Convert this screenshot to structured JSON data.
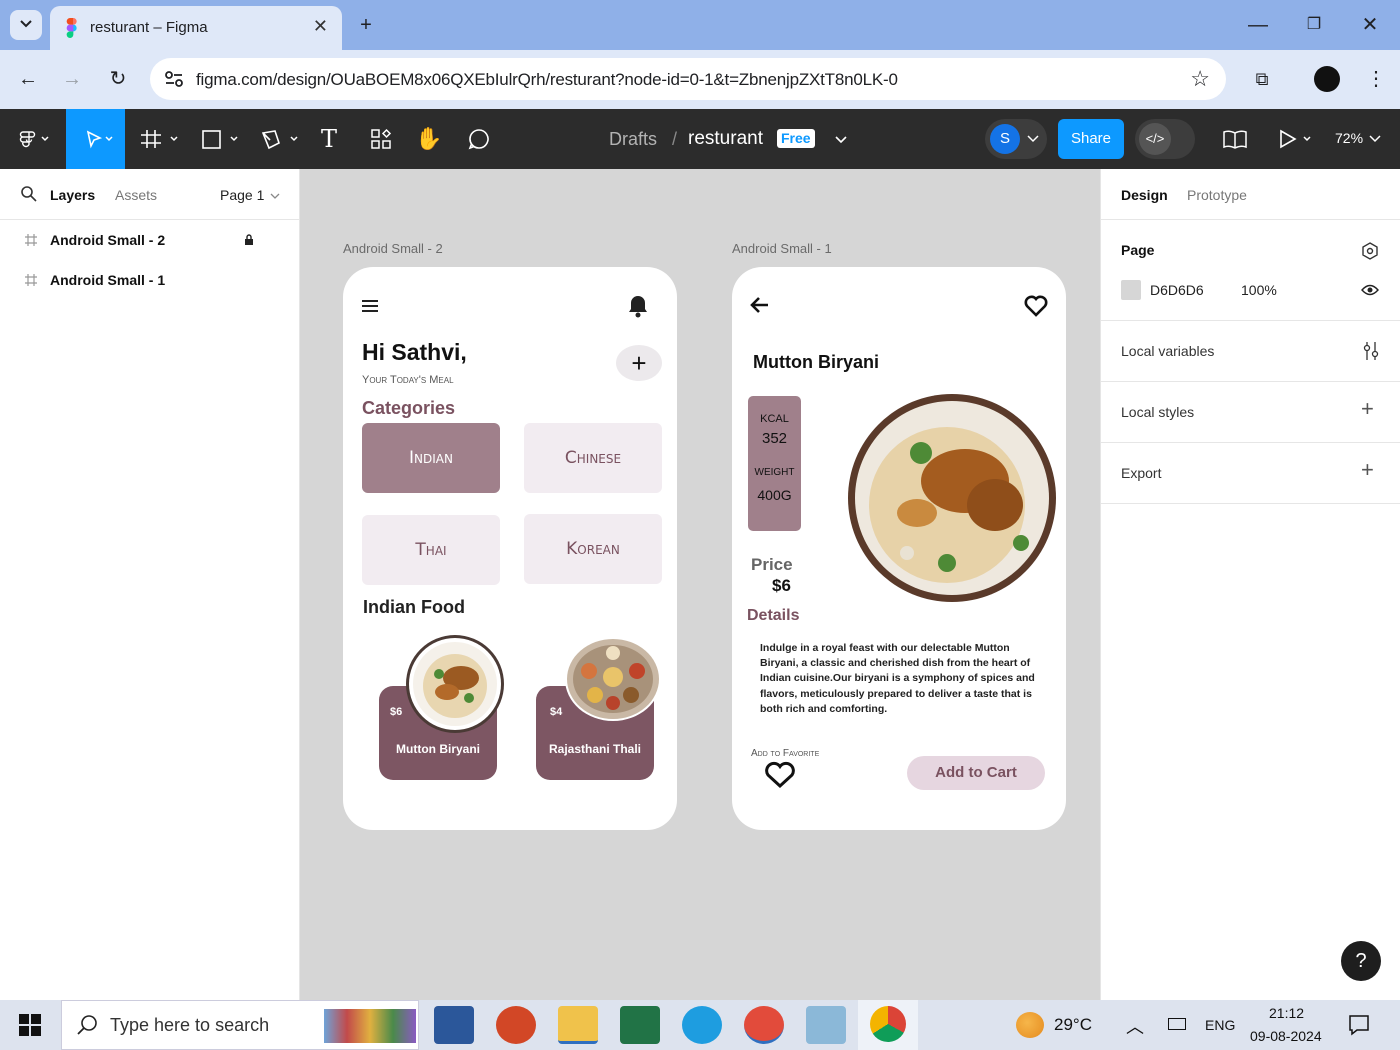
{
  "browser": {
    "tab_title": "resturant – Figma",
    "url": "figma.com/design/OUaBOEM8x06QXEbIulrQrh/resturant?node-id=0-1&t=ZbnenjpZXtT8n0LK-0"
  },
  "figma_toolbar": {
    "breadcrumb_root": "Drafts",
    "separator": "/",
    "file_name": "resturant",
    "plan_badge": "Free",
    "avatar_letter": "S",
    "share_label": "Share",
    "zoom": "72%"
  },
  "left_panel": {
    "tabs": [
      "Layers",
      "Assets"
    ],
    "page_selector": "Page 1",
    "layers": [
      "Android Small - 2",
      "Android Small - 1"
    ]
  },
  "right_panel": {
    "tabs": [
      "Design",
      "Prototype"
    ],
    "page_section": "Page",
    "page_color": "D6D6D6",
    "page_opacity": "100%",
    "sections": [
      "Local variables",
      "Local styles",
      "Export"
    ]
  },
  "canvas": {
    "frame2_label": "Android Small - 2",
    "frame1_label": "Android Small - 1",
    "home": {
      "greeting": "Hi Sathvi,",
      "subtitle": "Your Today's Meal",
      "categories_title": "Categories",
      "categories": [
        "Indian",
        "Chinese",
        "Thai",
        "Korean"
      ],
      "section_title": "Indian Food",
      "items": [
        {
          "price": "$6",
          "name": "Mutton Biryani"
        },
        {
          "price": "$4",
          "name": "Rajasthani Thali"
        }
      ]
    },
    "detail": {
      "title": "Mutton Biryani",
      "kcal_label": "KCAL",
      "kcal_value": "352",
      "weight_label": "WEIGHT",
      "weight_value": "400G",
      "price_label": "Price",
      "price_value": "$6",
      "details_label": "Details",
      "description": "Indulge in a royal feast with our delectable Mutton Biryani, a classic and cherished dish from the heart of Indian cuisine.Our biryani is a symphony of spices and flavors, meticulously prepared to deliver a taste that is both rich and comforting.",
      "favorite_label": "Add to Favorite",
      "cart_button": "Add to Cart"
    }
  },
  "help_button": "?",
  "taskbar": {
    "search_placeholder": "Type here to search",
    "weather": "29°C",
    "language": "ENG",
    "time": "21:12",
    "date": "09-08-2024"
  },
  "colors": {
    "accent_primary": "#0d99ff",
    "brand_mauve": "#7d5663",
    "category_active": "#a0808b",
    "category_bg": "#f2ecf1",
    "canvas_bg": "#d6d6d6"
  }
}
